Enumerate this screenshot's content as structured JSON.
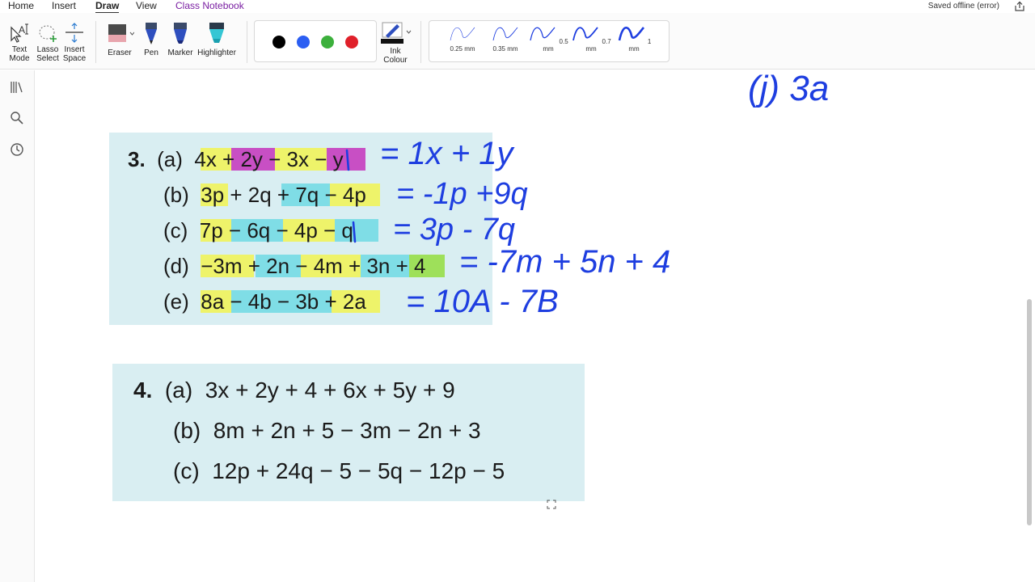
{
  "menu": {
    "tabs": [
      {
        "label": "Home"
      },
      {
        "label": "Insert"
      },
      {
        "label": "Draw"
      },
      {
        "label": "View"
      },
      {
        "label": "Class Notebook"
      }
    ],
    "status": "Saved offline (error)",
    "share_icon": "share-icon"
  },
  "ribbon": {
    "text_mode": "Text\nMode",
    "lasso": "Lasso\nSelect",
    "insert_space": "Insert\nSpace",
    "eraser": "Eraser",
    "pen": "Pen",
    "marker": "Marker",
    "highlighter": "Highlighter",
    "ink_colour": "Ink\nColour",
    "colors": [
      "#000000",
      "#2b5ef2",
      "#3cb03c",
      "#e0202a"
    ],
    "thicknesses": [
      "0.25 mm",
      "0.35 mm",
      "0.5 mm",
      "0.7 mm",
      "1 mm"
    ]
  },
  "sidebar": {
    "icons": [
      "notebooks-icon",
      "search-icon",
      "recent-clock-icon"
    ]
  },
  "ink_color": "#1e3ee0",
  "handwriting": {
    "top_note": "(j) 3a",
    "answers": [
      "= 1x + 1y",
      "= -1p +9q",
      "= 3p - 7q",
      "= -7m + 5n + 4",
      "= 10A - 7B"
    ]
  },
  "problem3": {
    "number": "3.",
    "rows": [
      {
        "label": "(a)",
        "expr": "4x + 2y − 3x − y"
      },
      {
        "label": "(b)",
        "expr": "3p + 2q + 7q − 4p"
      },
      {
        "label": "(c)",
        "expr": "7p − 6q − 4p − q"
      },
      {
        "label": "(d)",
        "expr": "−3m + 2n − 4m + 3n + 4"
      },
      {
        "label": "(e)",
        "expr": "8a − 4b − 3b + 2a"
      }
    ]
  },
  "problem4": {
    "number": "4.",
    "rows": [
      {
        "label": "(a)",
        "expr": "3x + 2y + 4 + 6x + 5y + 9"
      },
      {
        "label": "(b)",
        "expr": "8m + 2n + 5 − 3m − 2n + 3"
      },
      {
        "label": "(c)",
        "expr": "12p + 24q − 5 − 5q − 12p − 5"
      }
    ]
  }
}
